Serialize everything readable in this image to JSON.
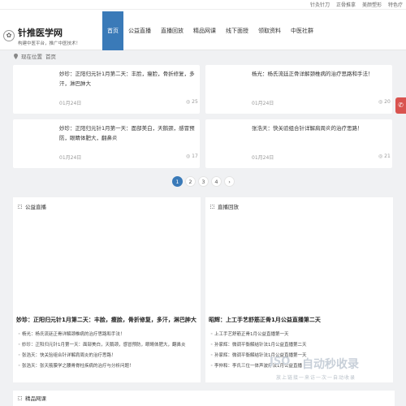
{
  "topbar": {
    "links": [
      "针灸针刀",
      "正骨推拿",
      "美颜塑形",
      "特色疗"
    ]
  },
  "header": {
    "logo_icon": "✿",
    "site_title": "针推医学网",
    "site_subtitle": "构建中医平台，推广中医技术！",
    "nav": [
      "首页",
      "公益直播",
      "直播回放",
      "精品网课",
      "线下面授",
      "领取资料",
      "中医社群"
    ]
  },
  "breadcrumb": {
    "icon": "location-pin-icon",
    "here": "现在位置",
    "home": "首页"
  },
  "cards": [
    {
      "title": "妙珍：正阳归元针1月第二天：丰脸，瘦脸，骨折修复，多汗，淋巴肿大",
      "date": "01月24日",
      "views": "25"
    },
    {
      "title": "杨光：杨氏流廷正骨详解颈椎病的治疗思路和手法！",
      "date": "01月24日",
      "views": "20"
    },
    {
      "title": "妙珍：正阳归元针1月第一天：面部美白，天鹅颈，感冒预防，眼睛体肥大，翻鼻炎",
      "date": "01月24日",
      "views": "17"
    },
    {
      "title": "张浩天：快关验组合针详解肩周炎的治疗思路！",
      "date": "01月24日",
      "views": "21"
    }
  ],
  "pager": {
    "pages": [
      "1",
      "2",
      "3",
      "4"
    ],
    "next": "›",
    "current": "1"
  },
  "panels": {
    "live": {
      "title": "公益直播",
      "feature": "妙珍：正阳归元针1月第二天：丰脸，瘦脸，骨折修复，多汗，淋巴肿大",
      "items": [
        "杨光：杨氏流廷正骨详解颈椎病的治疗思路和手法！",
        "妙珍：正阳归元针1月第一天：面部美白，天鹅颈，感冒预防，眼睛体肥大，翻鼻炎",
        "张浩天：快关验组合针详解肩周炎的治疗思路！",
        "张浩天：张天筋膜学之腰骨脊柱疾病的治疗与分析问题！"
      ]
    },
    "replay": {
      "title": "直播回放",
      "feature": "昭辉：上工手艺舒筋正骨1月公益直播第二天",
      "items": [
        "上工手艺舒筋正骨1月公益直播第一天",
        "孙家辉：微调平衡解结针法1月公益直播第二天",
        "孙家辉：微调平衡解结针法1月公益直播第一天",
        "李仲和：李氏三位一体声波疗法1月公益直播"
      ]
    },
    "courses": {
      "title": "精品网课"
    }
  },
  "watermark": {
    "logo": "JSO",
    "brand": "自动秒收录",
    "sub": "放上链接一来访一次一自动收录"
  },
  "float_button": "✆"
}
